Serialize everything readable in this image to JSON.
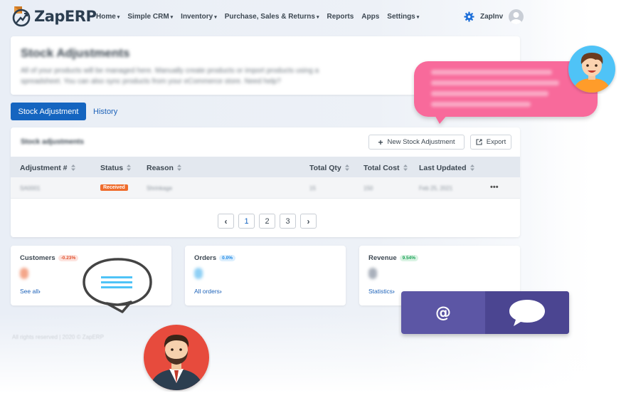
{
  "brand": {
    "name": "ZapERP"
  },
  "nav": {
    "items": [
      {
        "label": "Home",
        "dropdown": true
      },
      {
        "label": "Simple CRM",
        "dropdown": true
      },
      {
        "label": "Inventory",
        "dropdown": true
      },
      {
        "label": "Purchase, Sales & Returns",
        "dropdown": true
      },
      {
        "label": "Reports",
        "dropdown": false
      },
      {
        "label": "Apps",
        "dropdown": false
      },
      {
        "label": "Settings",
        "dropdown": true
      }
    ],
    "user_name": "ZapInv",
    "icons": {
      "settings": "gear-icon",
      "user": "avatar"
    }
  },
  "page": {
    "title": "Stock Adjustments",
    "description": "All of your products will be managed here. Manually create products or import products using a spreadsheet. You can also sync products from your eCommerce store. Need help?"
  },
  "tabs": [
    {
      "label": "Stock Adjustment",
      "active": true
    },
    {
      "label": "History",
      "active": false
    }
  ],
  "table": {
    "title": "Stock adjustments",
    "new_button": "New Stock Adjustment",
    "export_button": "Export",
    "columns": [
      "Adjustment #",
      "Status",
      "Reason",
      "Total Qty",
      "Total Cost",
      "Last Updated"
    ],
    "rows": [
      {
        "adjustment": "SA0001",
        "status": "Received",
        "reason": "Shrinkage",
        "total_qty": "15",
        "total_cost": "150",
        "last_updated": "Feb 25, 2021",
        "actions": "•••"
      }
    ]
  },
  "pagination": {
    "prev": "‹",
    "pages": [
      "1",
      "2",
      "3"
    ],
    "current": "1",
    "next": "›"
  },
  "stats": [
    {
      "label": "Customers",
      "change": "-0.23%",
      "link": "See all",
      "tone": "red",
      "color": "#f4a68a"
    },
    {
      "label": "Orders",
      "change": "0.0%",
      "link": "All orders",
      "tone": "blue",
      "color": "#8fd0f5"
    },
    {
      "label": "Revenue",
      "change": "9.54%",
      "link": "Statistics",
      "tone": "green",
      "color": "#a9b0bb"
    }
  ],
  "footer": {
    "text": "All rights reserved | 2020 © ZapERP"
  },
  "overlays": {
    "chat_bubble_color": "#f86a9b",
    "contact_widget": {
      "email_symbol": "@",
      "color_left": "#5c56a5",
      "color_right": "#4b4591",
      "icons": [
        "email-icon",
        "chat-icon"
      ]
    }
  },
  "colors": {
    "primary": "#1565c0",
    "badge_received": "#ef6c2c",
    "header_bg": "#e3e8ef"
  }
}
